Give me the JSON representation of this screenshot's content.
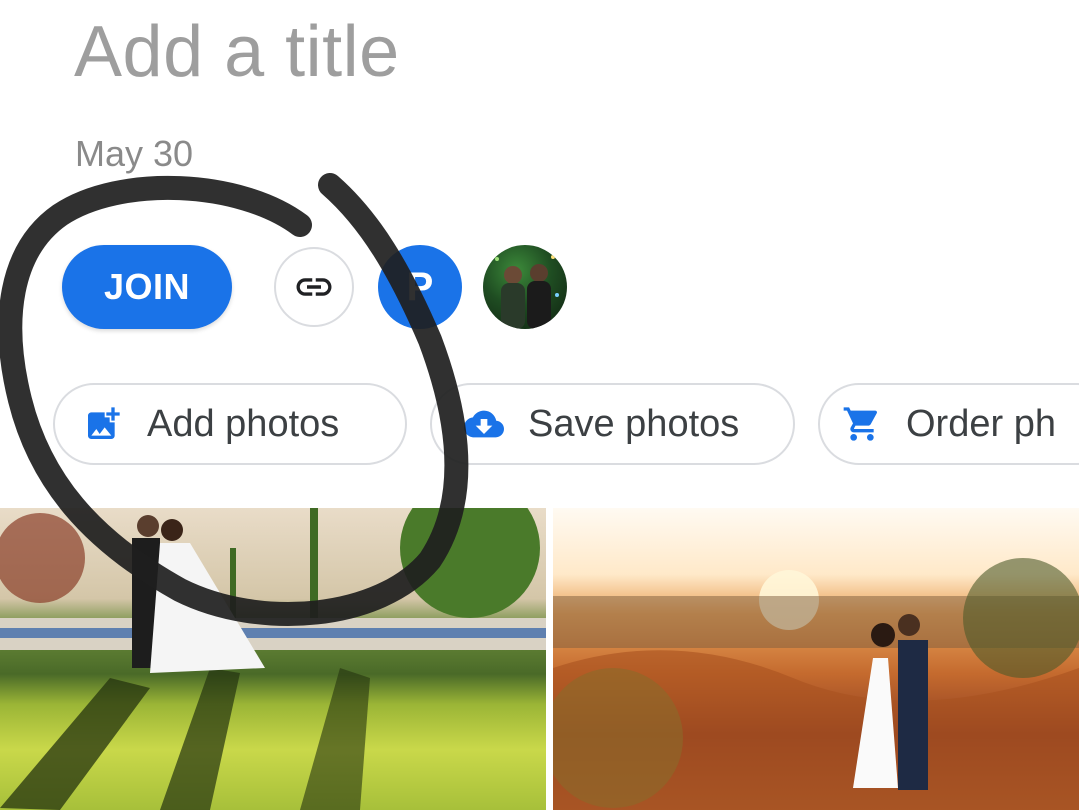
{
  "header": {
    "title": "Add a title",
    "date": "May 30"
  },
  "actions": {
    "join_label": "JOIN",
    "link_icon": "link-icon",
    "member_initial": "P",
    "member_color": "#1a73e8"
  },
  "chips": [
    {
      "label": "Add photos",
      "icon": "add-photo-icon"
    },
    {
      "label": "Save photos",
      "icon": "cloud-download-icon"
    },
    {
      "label": "Order ph",
      "icon": "shopping-cart-icon"
    }
  ],
  "colors": {
    "accent": "#1a73e8",
    "title_gray": "#9e9e9e",
    "annotation": "#1e1e1e"
  },
  "photos": [
    {
      "description": "wedding couple kissing on lawn"
    },
    {
      "description": "wedding couple at sunset in desert"
    }
  ]
}
